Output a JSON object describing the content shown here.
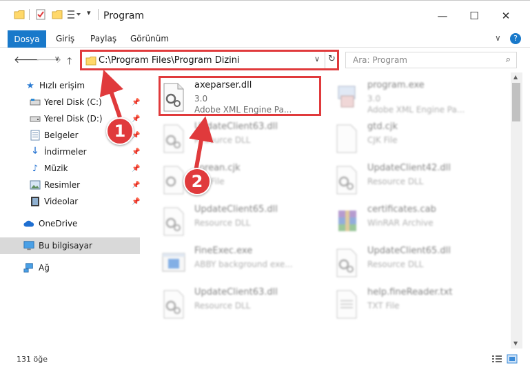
{
  "window": {
    "title": "Program",
    "minimize": "—",
    "maximize": "☐",
    "close": "✕"
  },
  "ribbon": {
    "file_tab": "Dosya",
    "tabs": [
      "Giriş",
      "Paylaş",
      "Görünüm"
    ],
    "expand": "∨",
    "help": "?"
  },
  "address": {
    "path": "C:\\Program Files\\Program Dizini",
    "search_placeholder": "Ara: Program"
  },
  "nav": {
    "items": [
      {
        "label": "Hızlı erişim",
        "icon": "star-icon"
      },
      {
        "label": "Yerel Disk (C:)",
        "icon": "drive-icon"
      },
      {
        "label": "Yerel Disk (D:)",
        "icon": "drive-icon"
      },
      {
        "label": "Belgeler",
        "icon": "document-icon"
      },
      {
        "label": "İndirmeler",
        "icon": "download-icon"
      },
      {
        "label": "Müzik",
        "icon": "music-icon"
      },
      {
        "label": "Resimler",
        "icon": "picture-icon"
      },
      {
        "label": "Videolar",
        "icon": "video-icon"
      },
      {
        "label": "OneDrive",
        "icon": "cloud-icon"
      },
      {
        "label": "Bu bilgisayar",
        "icon": "computer-icon"
      },
      {
        "label": "Ağ",
        "icon": "network-icon"
      }
    ]
  },
  "files": [
    {
      "name": "axeparser.dll",
      "line2": "3.0",
      "line3": "Adobe XML Engine Pa...",
      "icon": "dll-gear-icon"
    },
    {
      "name": "program.exe",
      "line2": "3.0",
      "line3": "Adobe XML Engine Pa...",
      "icon": "exe-icon"
    },
    {
      "name": "UpdateClient63.dll",
      "line2": "Resource DLL",
      "line3": "",
      "icon": "dll-gear-icon"
    },
    {
      "name": "gtd.cjk",
      "line2": "CJK File",
      "line3": "",
      "icon": "blank-file-icon"
    },
    {
      "name": "korean.cjk",
      "line2": "CJK File",
      "line3": "",
      "icon": "dll-gear-icon"
    },
    {
      "name": "UpdateClient42.dll",
      "line2": "Resource DLL",
      "line3": "",
      "icon": "dll-gear-icon"
    },
    {
      "name": "UpdateClient65.dll",
      "line2": "Resource DLL",
      "line3": "",
      "icon": "dll-gear-icon"
    },
    {
      "name": "certificates.cab",
      "line2": "WinRAR Archive",
      "line3": "",
      "icon": "winrar-icon"
    },
    {
      "name": "FineExec.exe",
      "line2": "ABBY background exe...",
      "line3": "",
      "icon": "exe-window-icon"
    },
    {
      "name": "UpdateClient65.dll",
      "line2": "Resource DLL",
      "line3": "",
      "icon": "dll-gear-icon"
    },
    {
      "name": "UpdateClient63.dll",
      "line2": "Resource DLL",
      "line3": "",
      "icon": "dll-gear-icon"
    },
    {
      "name": "help.fineReader.txt",
      "line2": "TXT File",
      "line3": "",
      "icon": "text-file-icon"
    }
  ],
  "status": {
    "count": "131 öğe"
  },
  "annotations": {
    "step1": "1",
    "step2": "2"
  },
  "colors": {
    "accent": "#1979ca",
    "highlight": "#e03a3c"
  }
}
